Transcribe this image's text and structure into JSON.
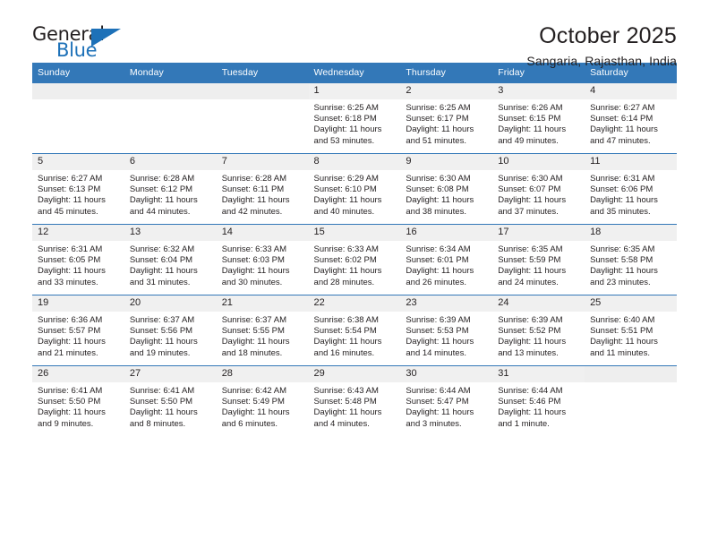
{
  "logo": {
    "word_one": "General",
    "word_two": "Blue",
    "triangle_icon": "triangle-icon",
    "accent_color": "#1d71b8"
  },
  "header": {
    "title": "October 2025",
    "subtitle": "Sangaria, Rajasthan, India"
  },
  "calendar": {
    "header_color": "#3378b8",
    "weekday_headers": [
      "Sunday",
      "Monday",
      "Tuesday",
      "Wednesday",
      "Thursday",
      "Friday",
      "Saturday"
    ],
    "weeks": [
      [
        {
          "date": "",
          "lines": []
        },
        {
          "date": "",
          "lines": []
        },
        {
          "date": "",
          "lines": []
        },
        {
          "date": "1",
          "lines": [
            "Sunrise: 6:25 AM",
            "Sunset: 6:18 PM",
            "Daylight: 11 hours",
            "and 53 minutes."
          ]
        },
        {
          "date": "2",
          "lines": [
            "Sunrise: 6:25 AM",
            "Sunset: 6:17 PM",
            "Daylight: 11 hours",
            "and 51 minutes."
          ]
        },
        {
          "date": "3",
          "lines": [
            "Sunrise: 6:26 AM",
            "Sunset: 6:15 PM",
            "Daylight: 11 hours",
            "and 49 minutes."
          ]
        },
        {
          "date": "4",
          "lines": [
            "Sunrise: 6:27 AM",
            "Sunset: 6:14 PM",
            "Daylight: 11 hours",
            "and 47 minutes."
          ]
        }
      ],
      [
        {
          "date": "5",
          "lines": [
            "Sunrise: 6:27 AM",
            "Sunset: 6:13 PM",
            "Daylight: 11 hours",
            "and 45 minutes."
          ]
        },
        {
          "date": "6",
          "lines": [
            "Sunrise: 6:28 AM",
            "Sunset: 6:12 PM",
            "Daylight: 11 hours",
            "and 44 minutes."
          ]
        },
        {
          "date": "7",
          "lines": [
            "Sunrise: 6:28 AM",
            "Sunset: 6:11 PM",
            "Daylight: 11 hours",
            "and 42 minutes."
          ]
        },
        {
          "date": "8",
          "lines": [
            "Sunrise: 6:29 AM",
            "Sunset: 6:10 PM",
            "Daylight: 11 hours",
            "and 40 minutes."
          ]
        },
        {
          "date": "9",
          "lines": [
            "Sunrise: 6:30 AM",
            "Sunset: 6:08 PM",
            "Daylight: 11 hours",
            "and 38 minutes."
          ]
        },
        {
          "date": "10",
          "lines": [
            "Sunrise: 6:30 AM",
            "Sunset: 6:07 PM",
            "Daylight: 11 hours",
            "and 37 minutes."
          ]
        },
        {
          "date": "11",
          "lines": [
            "Sunrise: 6:31 AM",
            "Sunset: 6:06 PM",
            "Daylight: 11 hours",
            "and 35 minutes."
          ]
        }
      ],
      [
        {
          "date": "12",
          "lines": [
            "Sunrise: 6:31 AM",
            "Sunset: 6:05 PM",
            "Daylight: 11 hours",
            "and 33 minutes."
          ]
        },
        {
          "date": "13",
          "lines": [
            "Sunrise: 6:32 AM",
            "Sunset: 6:04 PM",
            "Daylight: 11 hours",
            "and 31 minutes."
          ]
        },
        {
          "date": "14",
          "lines": [
            "Sunrise: 6:33 AM",
            "Sunset: 6:03 PM",
            "Daylight: 11 hours",
            "and 30 minutes."
          ]
        },
        {
          "date": "15",
          "lines": [
            "Sunrise: 6:33 AM",
            "Sunset: 6:02 PM",
            "Daylight: 11 hours",
            "and 28 minutes."
          ]
        },
        {
          "date": "16",
          "lines": [
            "Sunrise: 6:34 AM",
            "Sunset: 6:01 PM",
            "Daylight: 11 hours",
            "and 26 minutes."
          ]
        },
        {
          "date": "17",
          "lines": [
            "Sunrise: 6:35 AM",
            "Sunset: 5:59 PM",
            "Daylight: 11 hours",
            "and 24 minutes."
          ]
        },
        {
          "date": "18",
          "lines": [
            "Sunrise: 6:35 AM",
            "Sunset: 5:58 PM",
            "Daylight: 11 hours",
            "and 23 minutes."
          ]
        }
      ],
      [
        {
          "date": "19",
          "lines": [
            "Sunrise: 6:36 AM",
            "Sunset: 5:57 PM",
            "Daylight: 11 hours",
            "and 21 minutes."
          ]
        },
        {
          "date": "20",
          "lines": [
            "Sunrise: 6:37 AM",
            "Sunset: 5:56 PM",
            "Daylight: 11 hours",
            "and 19 minutes."
          ]
        },
        {
          "date": "21",
          "lines": [
            "Sunrise: 6:37 AM",
            "Sunset: 5:55 PM",
            "Daylight: 11 hours",
            "and 18 minutes."
          ]
        },
        {
          "date": "22",
          "lines": [
            "Sunrise: 6:38 AM",
            "Sunset: 5:54 PM",
            "Daylight: 11 hours",
            "and 16 minutes."
          ]
        },
        {
          "date": "23",
          "lines": [
            "Sunrise: 6:39 AM",
            "Sunset: 5:53 PM",
            "Daylight: 11 hours",
            "and 14 minutes."
          ]
        },
        {
          "date": "24",
          "lines": [
            "Sunrise: 6:39 AM",
            "Sunset: 5:52 PM",
            "Daylight: 11 hours",
            "and 13 minutes."
          ]
        },
        {
          "date": "25",
          "lines": [
            "Sunrise: 6:40 AM",
            "Sunset: 5:51 PM",
            "Daylight: 11 hours",
            "and 11 minutes."
          ]
        }
      ],
      [
        {
          "date": "26",
          "lines": [
            "Sunrise: 6:41 AM",
            "Sunset: 5:50 PM",
            "Daylight: 11 hours",
            "and 9 minutes."
          ]
        },
        {
          "date": "27",
          "lines": [
            "Sunrise: 6:41 AM",
            "Sunset: 5:50 PM",
            "Daylight: 11 hours",
            "and 8 minutes."
          ]
        },
        {
          "date": "28",
          "lines": [
            "Sunrise: 6:42 AM",
            "Sunset: 5:49 PM",
            "Daylight: 11 hours",
            "and 6 minutes."
          ]
        },
        {
          "date": "29",
          "lines": [
            "Sunrise: 6:43 AM",
            "Sunset: 5:48 PM",
            "Daylight: 11 hours",
            "and 4 minutes."
          ]
        },
        {
          "date": "30",
          "lines": [
            "Sunrise: 6:44 AM",
            "Sunset: 5:47 PM",
            "Daylight: 11 hours",
            "and 3 minutes."
          ]
        },
        {
          "date": "31",
          "lines": [
            "Sunrise: 6:44 AM",
            "Sunset: 5:46 PM",
            "Daylight: 11 hours",
            "and 1 minute."
          ]
        },
        {
          "date": "",
          "lines": []
        }
      ]
    ]
  }
}
